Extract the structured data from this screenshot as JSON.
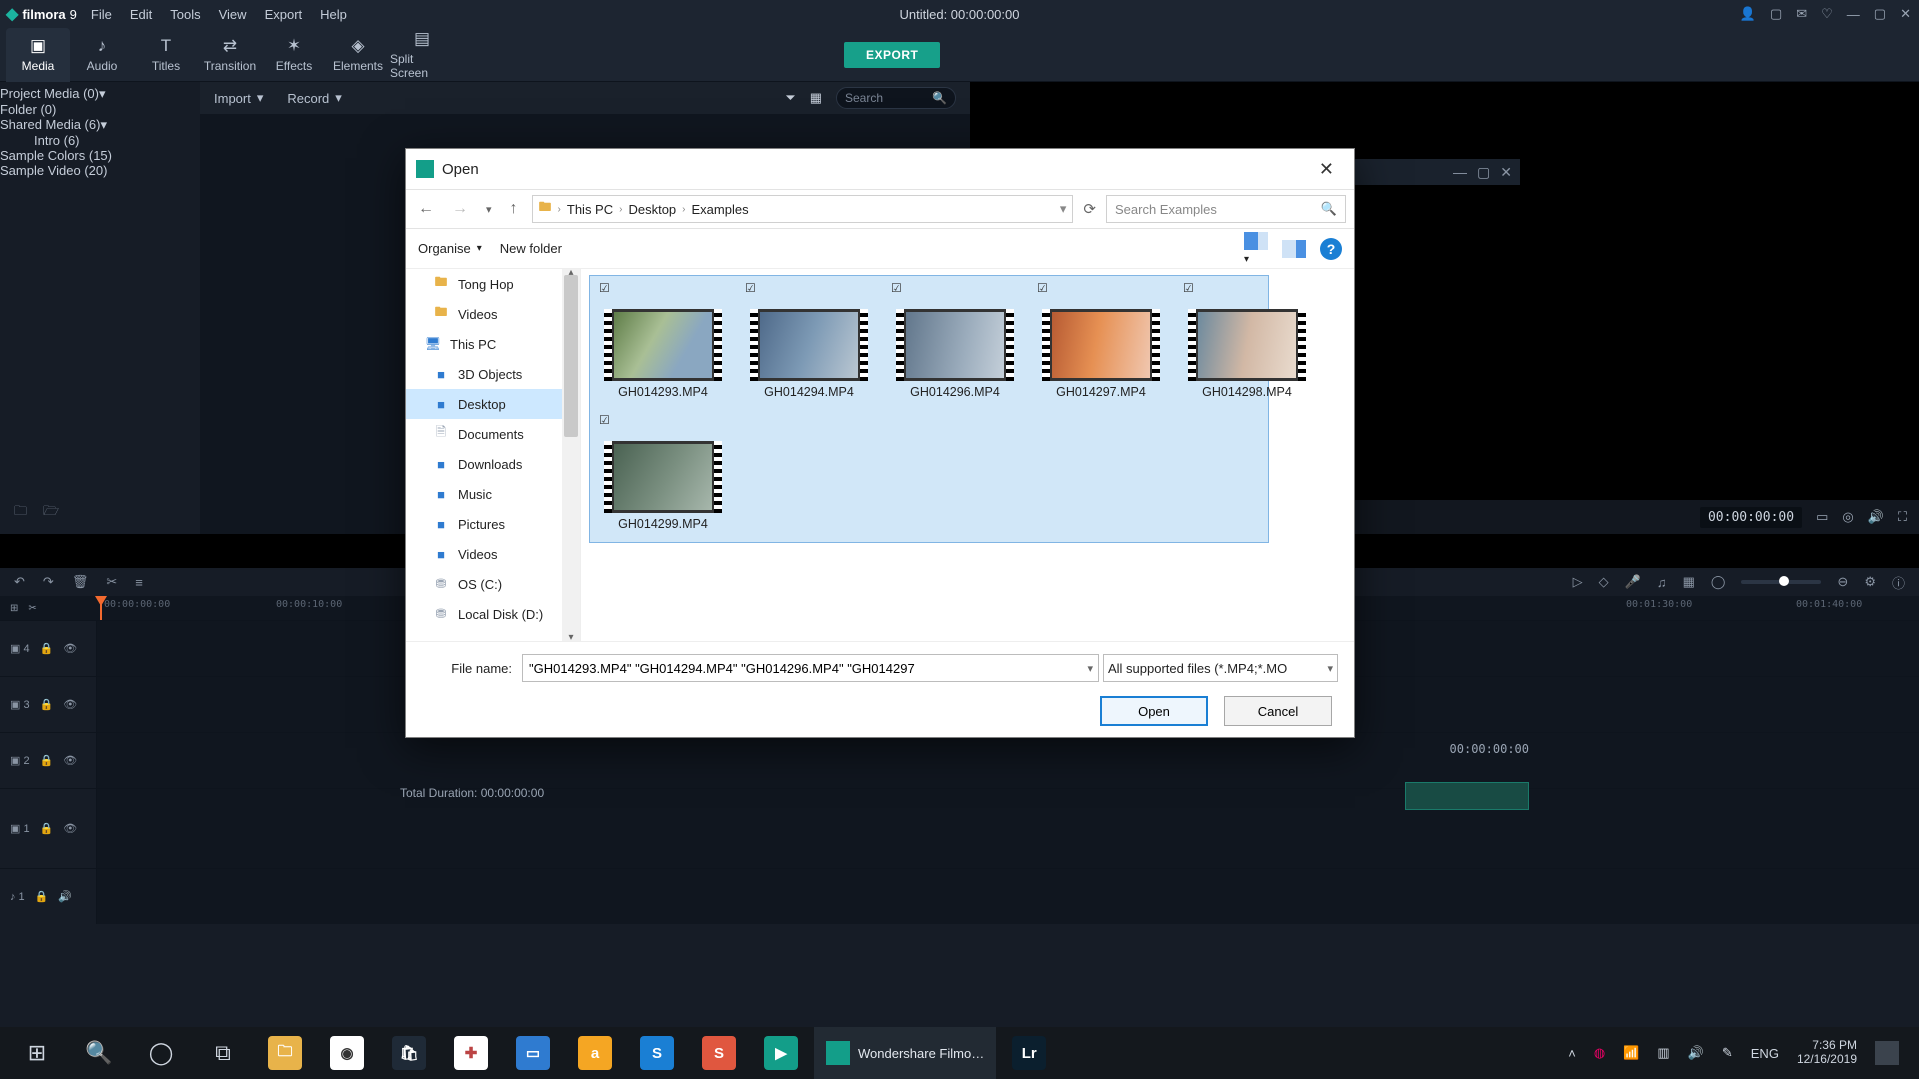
{
  "app": {
    "brand": "filmora",
    "brand_suffix": "9",
    "menu": [
      "File",
      "Edit",
      "Tools",
      "View",
      "Export",
      "Help"
    ],
    "doc_title": "Untitled:  00:00:00:00",
    "export_label": "EXPORT"
  },
  "tools": [
    {
      "label": "Media",
      "icon": "▣"
    },
    {
      "label": "Audio",
      "icon": "♪"
    },
    {
      "label": "Titles",
      "icon": "T"
    },
    {
      "label": "Transition",
      "icon": "⇄"
    },
    {
      "label": "Effects",
      "icon": "✶"
    },
    {
      "label": "Elements",
      "icon": "◈"
    },
    {
      "label": "Split Screen",
      "icon": "▤"
    }
  ],
  "side": {
    "project": "Project Media (0)",
    "folder": "Folder (0)",
    "shared": "Shared Media (6)",
    "intro": "Intro (6)",
    "colors": "Sample Colors (15)",
    "video": "Sample Video (20)"
  },
  "mediabar": {
    "import": "Import",
    "record": "Record",
    "search_placeholder": "Search"
  },
  "preview": {
    "tc_nav": "00:00:00:00",
    "tc_end": "00:00:00:00",
    "total_label": "Total Duration:",
    "total_value": "00:00:00:00"
  },
  "ruler": {
    "t0": "00:00:00:00",
    "t1": "00:00:10:00",
    "t2": "00:01:30:00",
    "t3": "00:01:40:00"
  },
  "tracks": [
    {
      "name": "▣ 4"
    },
    {
      "name": "▣ 3"
    },
    {
      "name": "▣ 2"
    },
    {
      "name": "▣ 1"
    },
    {
      "name": "♪ 1"
    }
  ],
  "dialog": {
    "title": "Open",
    "crumbs": [
      "This PC",
      "Desktop",
      "Examples"
    ],
    "search_placeholder": "Search Examples",
    "organise": "Organise",
    "newfolder": "New folder",
    "tree": [
      {
        "label": "Tong Hop",
        "icon": "folder"
      },
      {
        "label": "Videos",
        "icon": "folder"
      },
      {
        "label": "This PC",
        "icon": "pc",
        "pc": true
      },
      {
        "label": "3D Objects",
        "icon": "blue"
      },
      {
        "label": "Desktop",
        "icon": "blue",
        "selected": true
      },
      {
        "label": "Documents",
        "icon": "doc"
      },
      {
        "label": "Downloads",
        "icon": "blue"
      },
      {
        "label": "Music",
        "icon": "blue"
      },
      {
        "label": "Pictures",
        "icon": "blue"
      },
      {
        "label": "Videos",
        "icon": "blue"
      },
      {
        "label": "OS (C:)",
        "icon": "drive"
      },
      {
        "label": "Local Disk (D:)",
        "icon": "drive"
      }
    ],
    "files": [
      {
        "name": "GH014293.MP4",
        "img": "img1"
      },
      {
        "name": "GH014294.MP4",
        "img": "img2"
      },
      {
        "name": "GH014296.MP4",
        "img": "img3"
      },
      {
        "name": "GH014297.MP4",
        "img": "img4"
      },
      {
        "name": "GH014298.MP4",
        "img": "img5"
      },
      {
        "name": "GH014299.MP4",
        "img": "img6"
      }
    ],
    "filename_label": "File name:",
    "filename_value": "\"GH014293.MP4\" \"GH014294.MP4\" \"GH014296.MP4\" \"GH014297",
    "filter": "All supported files (*.MP4;*.MO",
    "open": "Open",
    "cancel": "Cancel"
  },
  "taskbar": {
    "active": "Wondershare Filmo…",
    "lang": "ENG",
    "time": "7:36 PM",
    "date": "12/16/2019"
  }
}
